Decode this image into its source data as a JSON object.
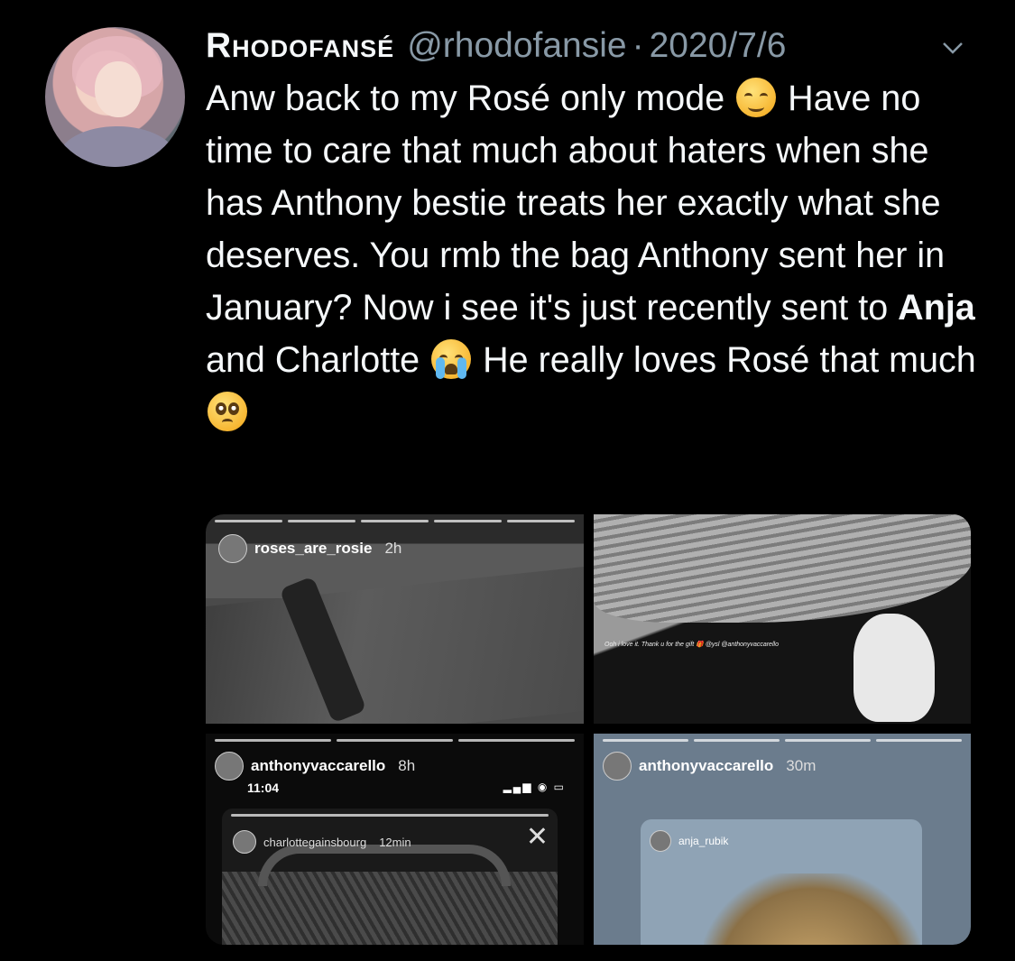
{
  "tweet": {
    "display_name": "Rhodofansé",
    "handle": "@rhodofansie",
    "separator": "·",
    "date": "2020/7/6",
    "text_parts": {
      "p1": "Anw back to my Rosé only mode",
      "p2": " Have no time to care that much about haters when she has Anthony bestie treats her exactly what she deserves. You rmb the bag Anthony sent her in January? Now i see it's just recently sent to ",
      "p3_bold": "Anja",
      "p4": " and Charlotte",
      "p5": " He really loves Rosé that much"
    },
    "emojis": [
      "relieved-face",
      "loudly-crying-face",
      "pleading-face"
    ]
  },
  "media": {
    "image1": {
      "user": "roses_are_rosie",
      "time": "2h"
    },
    "image2": {
      "caption": "Ooh i love it. Thank u for the gift 🎁 @ysl @anthonyvaccarello"
    },
    "image3": {
      "user": "anthonyvaccarello",
      "time": "8h",
      "status_time": "11:04",
      "inner_user": "charlottegainsbourg",
      "inner_time": "12min"
    },
    "image4": {
      "user": "anthonyvaccarello",
      "time": "30m",
      "inner_user": "anja_rubik"
    }
  },
  "colors": {
    "background": "#000000",
    "text": "#f5f8fa",
    "secondary": "#8899a6"
  }
}
